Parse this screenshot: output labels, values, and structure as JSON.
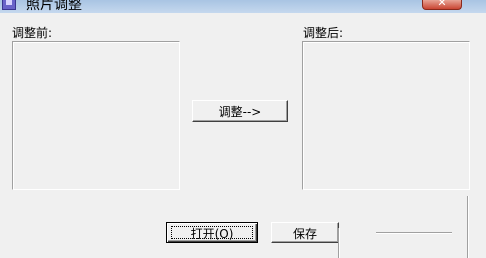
{
  "window": {
    "title": "照片调整",
    "close_symbol": "✕"
  },
  "left_panel": {
    "label": "调整前:"
  },
  "right_panel": {
    "label": "调整后:"
  },
  "buttons": {
    "adjust_label": "调整-->",
    "open_label": "打开(O)",
    "save_label": "保存"
  },
  "icons": {
    "app": "app-icon",
    "close": "close-icon"
  }
}
